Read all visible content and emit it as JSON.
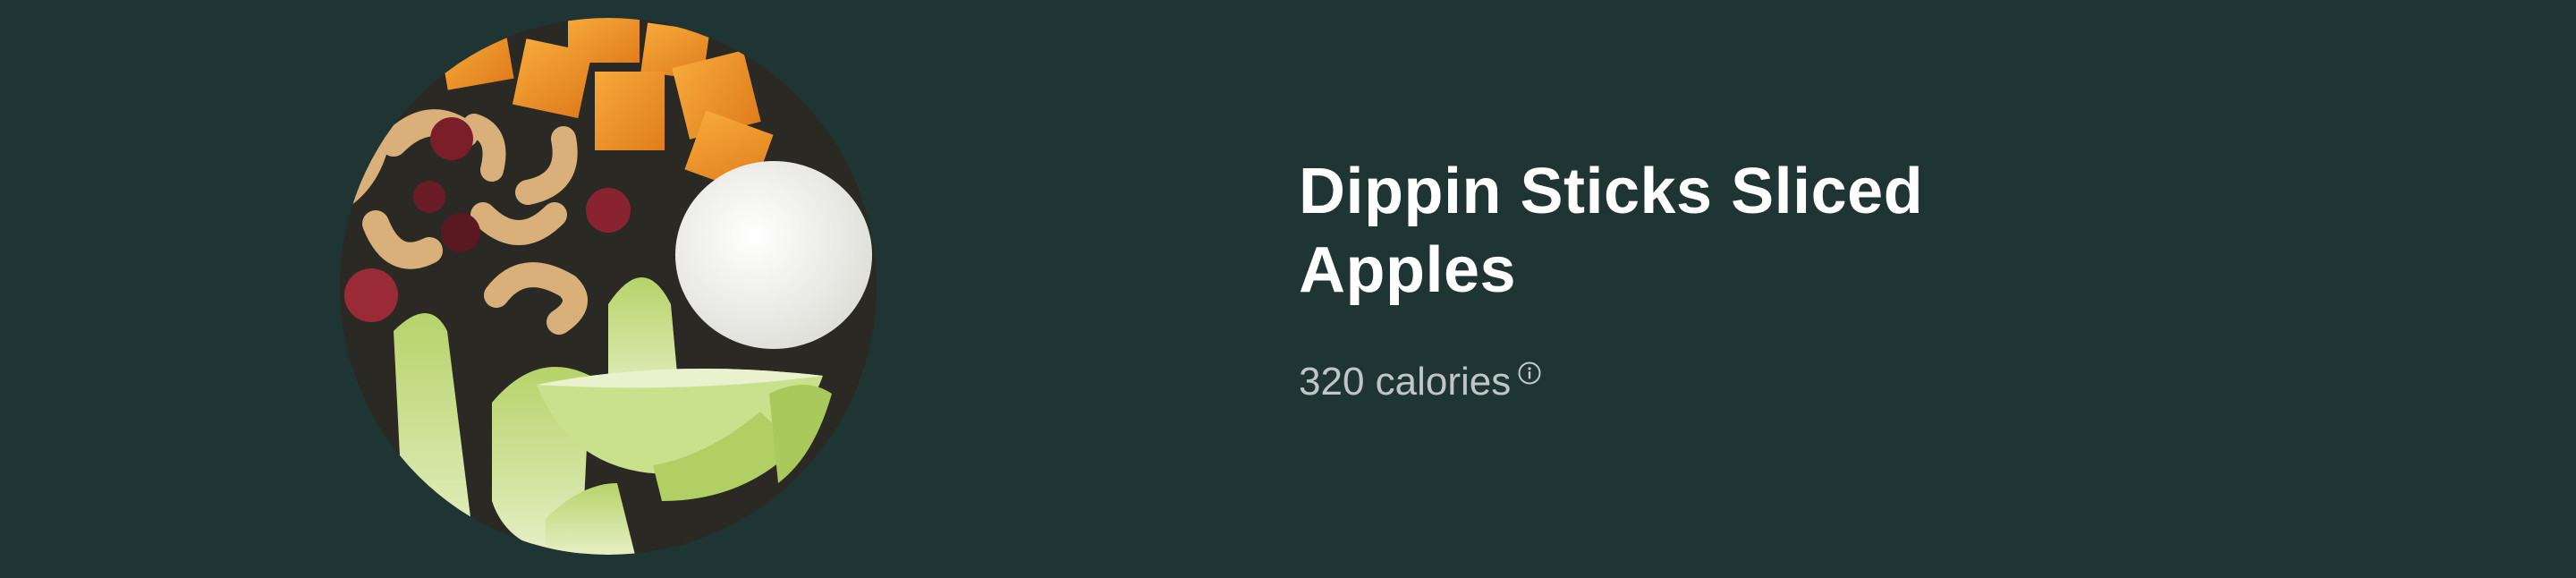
{
  "product": {
    "name": "Dippin Sticks Sliced Apples",
    "calories": "320 calories",
    "image_icon": "food-photo",
    "info_icon": "info-icon"
  },
  "colors": {
    "background": "#1f3533",
    "title": "#ffffff",
    "calories_text": "#b8c0bf"
  }
}
